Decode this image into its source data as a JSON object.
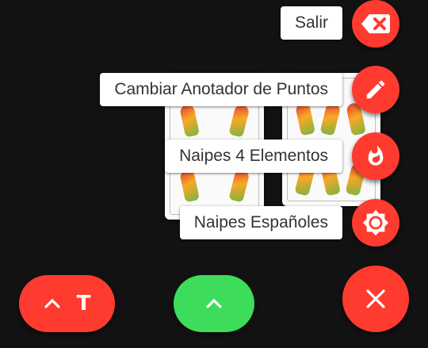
{
  "menu": {
    "items": [
      {
        "label": "Salir",
        "icon": "backspace-icon"
      },
      {
        "label": "Cambiar Anotador de Puntos",
        "icon": "pencil-icon"
      },
      {
        "label": "Naipes 4 Elementos",
        "icon": "fire-icon"
      },
      {
        "label": "Naipes Españoles",
        "icon": "brightness-icon"
      }
    ],
    "close_icon": "close-icon"
  },
  "bottom_bar": {
    "left_button": {
      "icons": [
        "chevron-up-icon",
        "text-icon"
      ],
      "text_glyph": "T"
    },
    "center_button": {
      "icon": "chevron-up-icon"
    }
  },
  "colors": {
    "background": "#121212",
    "accent_red": "#ff3b2f",
    "accent_green": "#3ddc5a",
    "label_bg": "#ffffff",
    "label_text": "#333333"
  }
}
